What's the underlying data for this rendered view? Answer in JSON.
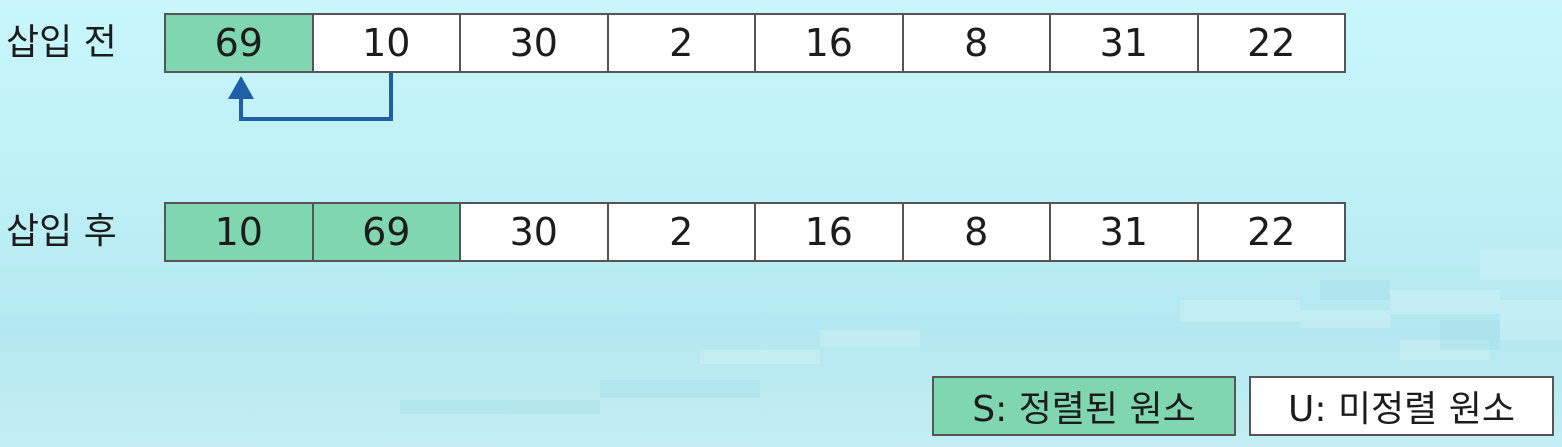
{
  "before": {
    "label": "삽입 전",
    "cells": [
      {
        "value": "69",
        "sorted": true
      },
      {
        "value": "10",
        "sorted": false
      },
      {
        "value": "30",
        "sorted": false
      },
      {
        "value": "2",
        "sorted": false
      },
      {
        "value": "16",
        "sorted": false
      },
      {
        "value": "8",
        "sorted": false
      },
      {
        "value": "31",
        "sorted": false
      },
      {
        "value": "22",
        "sorted": false
      }
    ]
  },
  "after": {
    "label": "삽입 후",
    "cells": [
      {
        "value": "10",
        "sorted": true
      },
      {
        "value": "69",
        "sorted": true
      },
      {
        "value": "30",
        "sorted": false
      },
      {
        "value": "2",
        "sorted": false
      },
      {
        "value": "16",
        "sorted": false
      },
      {
        "value": "8",
        "sorted": false
      },
      {
        "value": "31",
        "sorted": false
      },
      {
        "value": "22",
        "sorted": false
      }
    ]
  },
  "legend": {
    "sorted_label": "S: 정렬된 원소",
    "unsorted_label": "U: 미정렬 원소"
  },
  "colors": {
    "sorted": "#7fd6b0",
    "unsorted": "#ffffff",
    "arrow": "#1f5fa8"
  }
}
